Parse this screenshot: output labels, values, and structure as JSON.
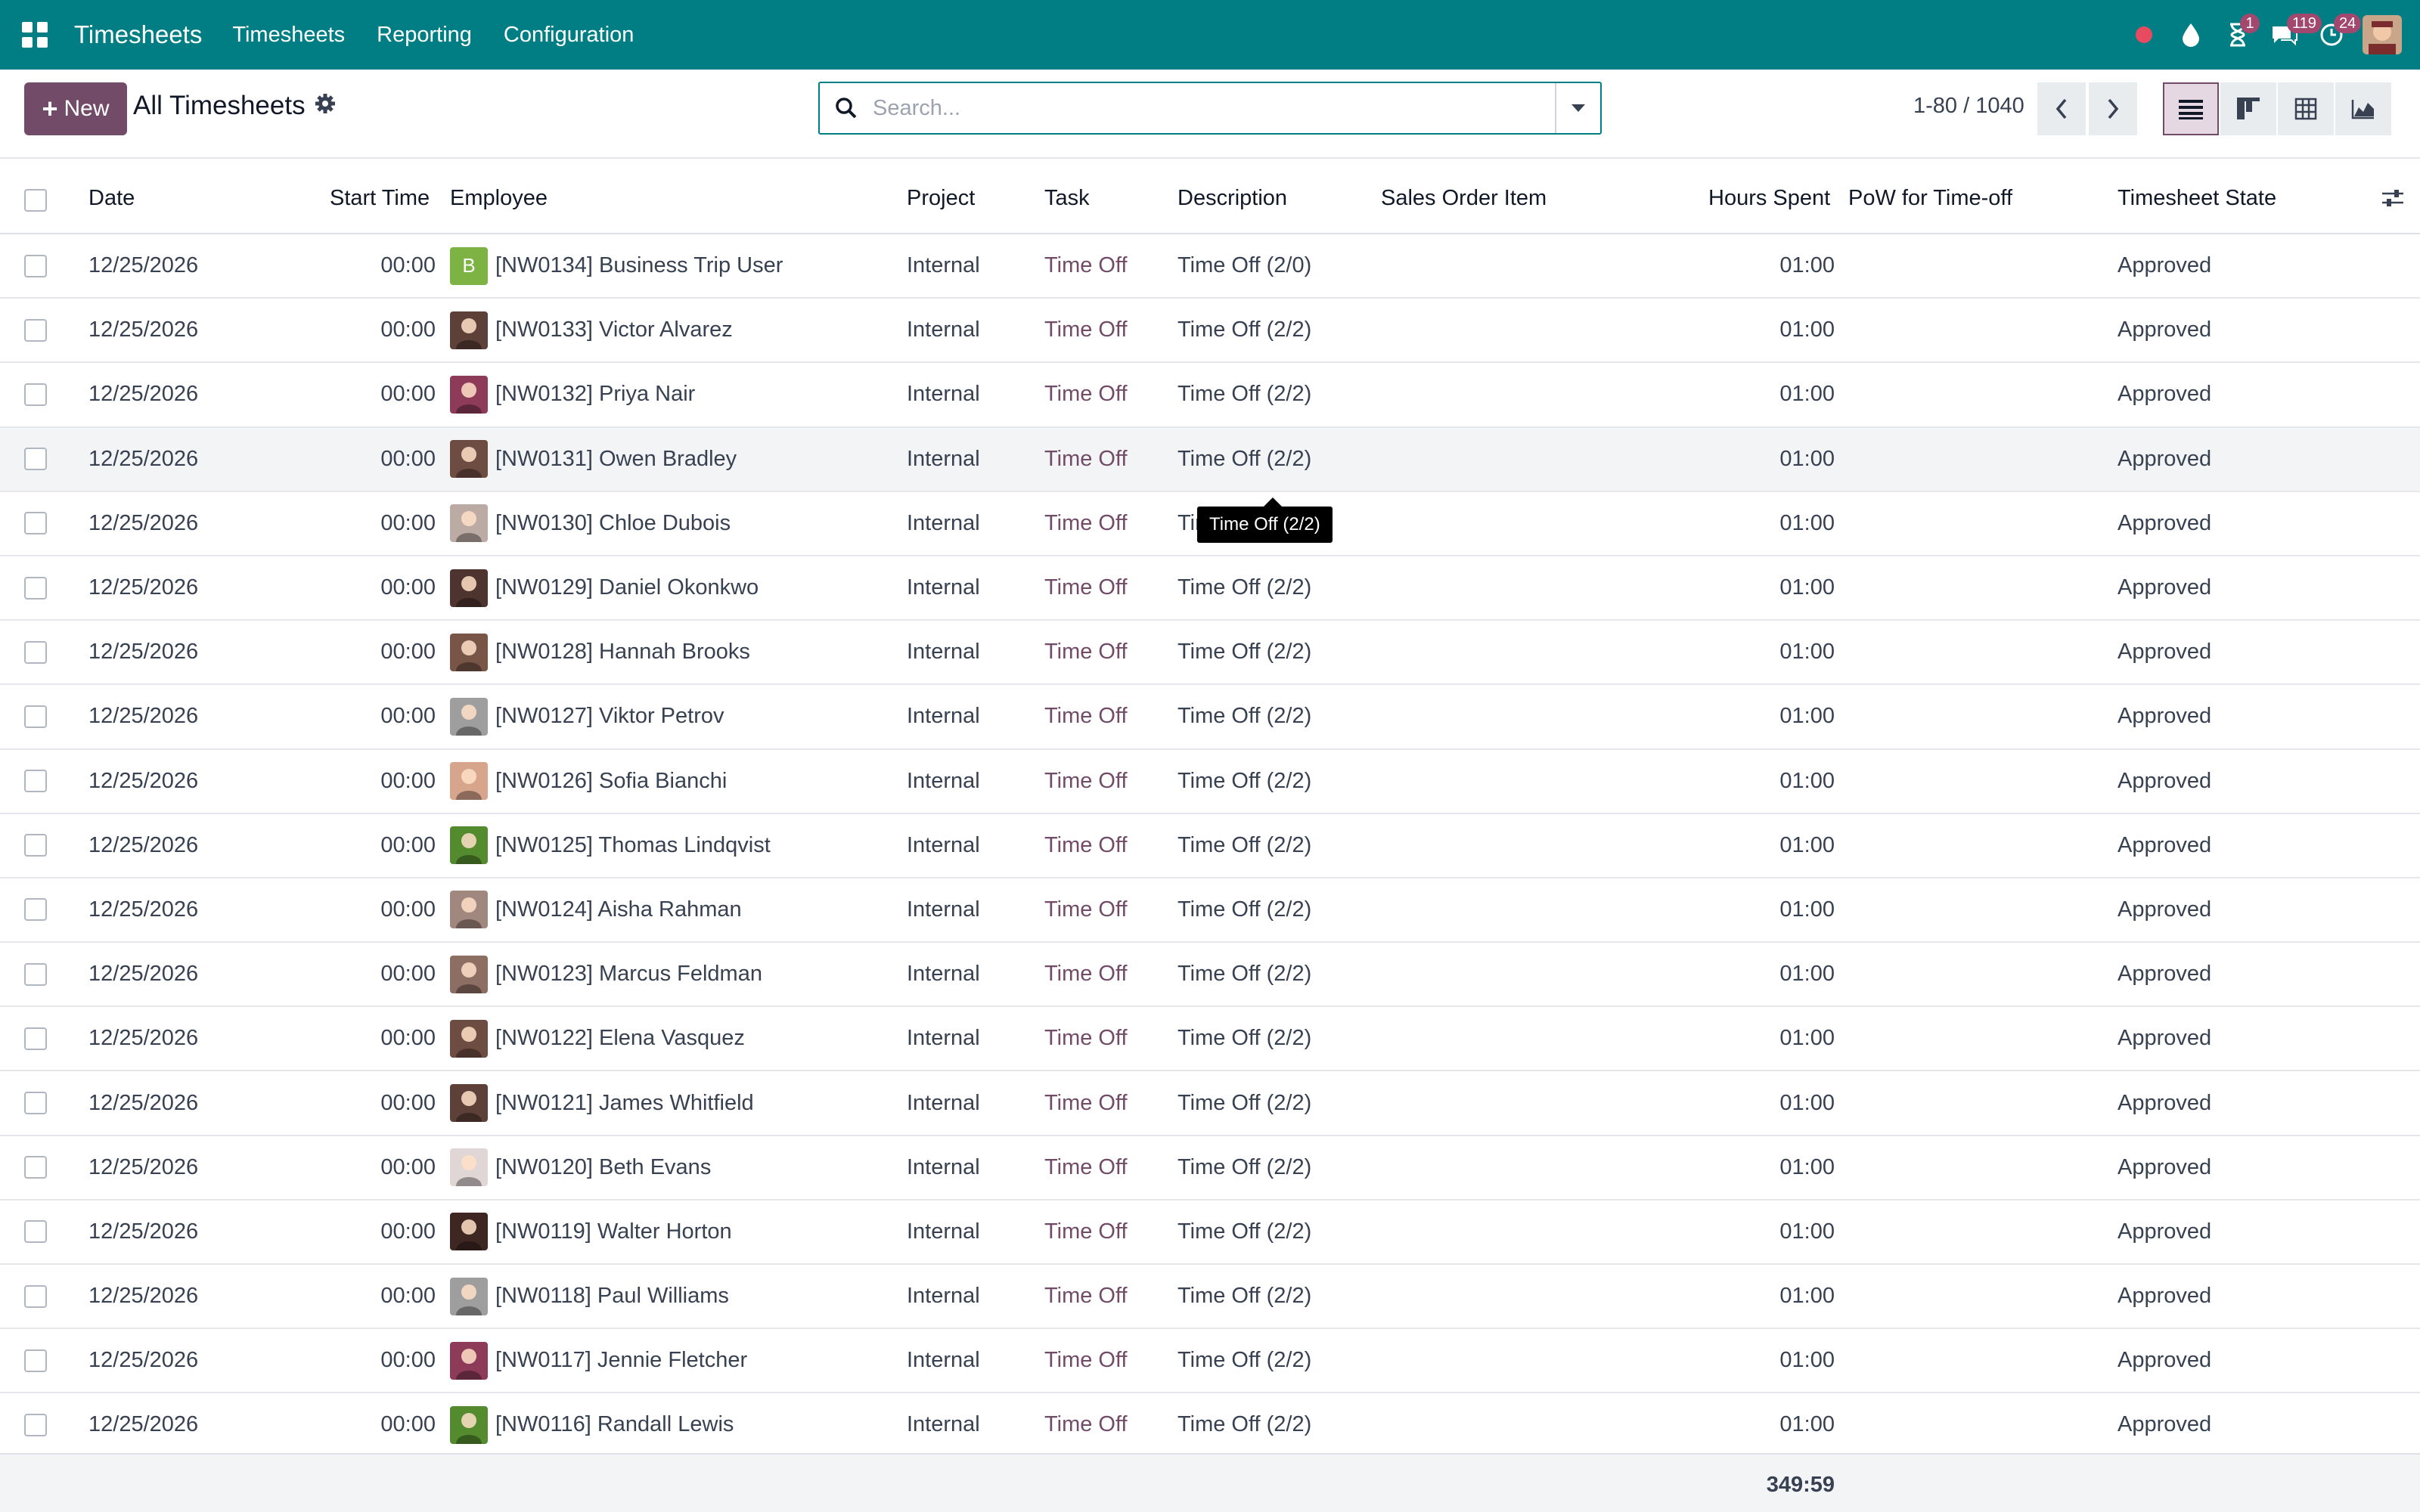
{
  "navbar": {
    "brand": "Timesheets",
    "menus": [
      "Timesheets",
      "Reporting",
      "Configuration"
    ],
    "badges": {
      "activities": "1",
      "messages": "119",
      "updates": "24"
    },
    "colors": {
      "bar": "#017e84",
      "badge": "#a2476e",
      "record_dot": "#e84a5f"
    }
  },
  "control_panel": {
    "new_label": "New",
    "breadcrumb": "All Timesheets",
    "search_placeholder": "Search...",
    "pager": "1-80 / 1040",
    "views": [
      "list-view-icon",
      "kanban-view-icon",
      "grid-view-icon",
      "graph-view-icon"
    ],
    "active_view": "list-view-icon"
  },
  "table": {
    "columns": [
      "Date",
      "Start Time",
      "Employee",
      "Project",
      "Task",
      "Description",
      "Sales Order Item",
      "Hours Spent",
      "PoW for Time-off",
      "Timesheet State"
    ],
    "rows": [
      {
        "date": "12/25/2026",
        "start": "00:00",
        "employee": "[NW0134] Business Trip User",
        "avatar_letter": "B",
        "avatar_color": "#7cb342",
        "project": "Internal",
        "task": "Time Off",
        "description": "Time Off (2/0)",
        "so_item": "",
        "hours": "01:00",
        "pow": "",
        "state": "Approved"
      },
      {
        "date": "12/25/2026",
        "start": "00:00",
        "employee": "[NW0133] Victor Alvarez",
        "avatar_letter": "",
        "avatar_color": "#5d4037",
        "project": "Internal",
        "task": "Time Off",
        "description": "Time Off (2/2)",
        "so_item": "",
        "hours": "01:00",
        "pow": "",
        "state": "Approved"
      },
      {
        "date": "12/25/2026",
        "start": "00:00",
        "employee": "[NW0132] Priya Nair",
        "avatar_letter": "",
        "avatar_color": "#8e3b5a",
        "project": "Internal",
        "task": "Time Off",
        "description": "Time Off (2/2)",
        "so_item": "",
        "hours": "01:00",
        "pow": "",
        "state": "Approved"
      },
      {
        "date": "12/25/2026",
        "start": "00:00",
        "employee": "[NW0131] Owen Bradley",
        "avatar_letter": "",
        "avatar_color": "#6d4c41",
        "project": "Internal",
        "task": "Time Off",
        "description": "Time Off (2/2)",
        "so_item": "",
        "hours": "01:00",
        "pow": "",
        "state": "Approved"
      },
      {
        "date": "12/25/2026",
        "start": "00:00",
        "employee": "[NW0130] Chloe Dubois",
        "avatar_letter": "",
        "avatar_color": "#bcaaa4",
        "project": "Internal",
        "task": "Time Off",
        "description": "Time Off (2/2)",
        "so_item": "",
        "hours": "01:00",
        "pow": "",
        "state": "Approved"
      },
      {
        "date": "12/25/2026",
        "start": "00:00",
        "employee": "[NW0129] Daniel Okonkwo",
        "avatar_letter": "",
        "avatar_color": "#4e342e",
        "project": "Internal",
        "task": "Time Off",
        "description": "Time Off (2/2)",
        "so_item": "",
        "hours": "01:00",
        "pow": "",
        "state": "Approved"
      },
      {
        "date": "12/25/2026",
        "start": "00:00",
        "employee": "[NW0128] Hannah Brooks",
        "avatar_letter": "",
        "avatar_color": "#795548",
        "project": "Internal",
        "task": "Time Off",
        "description": "Time Off (2/2)",
        "so_item": "",
        "hours": "01:00",
        "pow": "",
        "state": "Approved"
      },
      {
        "date": "12/25/2026",
        "start": "00:00",
        "employee": "[NW0127] Viktor Petrov",
        "avatar_letter": "",
        "avatar_color": "#9e9e9e",
        "project": "Internal",
        "task": "Time Off",
        "description": "Time Off (2/2)",
        "so_item": "",
        "hours": "01:00",
        "pow": "",
        "state": "Approved"
      },
      {
        "date": "12/25/2026",
        "start": "00:00",
        "employee": "[NW0126] Sofia Bianchi",
        "avatar_letter": "",
        "avatar_color": "#d7a48c",
        "project": "Internal",
        "task": "Time Off",
        "description": "Time Off (2/2)",
        "so_item": "",
        "hours": "01:00",
        "pow": "",
        "state": "Approved"
      },
      {
        "date": "12/25/2026",
        "start": "00:00",
        "employee": "[NW0125] Thomas Lindqvist",
        "avatar_letter": "",
        "avatar_color": "#558b2f",
        "project": "Internal",
        "task": "Time Off",
        "description": "Time Off (2/2)",
        "so_item": "",
        "hours": "01:00",
        "pow": "",
        "state": "Approved"
      },
      {
        "date": "12/25/2026",
        "start": "00:00",
        "employee": "[NW0124] Aisha Rahman",
        "avatar_letter": "",
        "avatar_color": "#a1887f",
        "project": "Internal",
        "task": "Time Off",
        "description": "Time Off (2/2)",
        "so_item": "",
        "hours": "01:00",
        "pow": "",
        "state": "Approved"
      },
      {
        "date": "12/25/2026",
        "start": "00:00",
        "employee": "[NW0123] Marcus Feldman",
        "avatar_letter": "",
        "avatar_color": "#8d6e63",
        "project": "Internal",
        "task": "Time Off",
        "description": "Time Off (2/2)",
        "so_item": "",
        "hours": "01:00",
        "pow": "",
        "state": "Approved"
      },
      {
        "date": "12/25/2026",
        "start": "00:00",
        "employee": "[NW0122] Elena Vasquez",
        "avatar_letter": "",
        "avatar_color": "#6d4c41",
        "project": "Internal",
        "task": "Time Off",
        "description": "Time Off (2/2)",
        "so_item": "",
        "hours": "01:00",
        "pow": "",
        "state": "Approved"
      },
      {
        "date": "12/25/2026",
        "start": "00:00",
        "employee": "[NW0121] James Whitfield",
        "avatar_letter": "",
        "avatar_color": "#5d4037",
        "project": "Internal",
        "task": "Time Off",
        "description": "Time Off (2/2)",
        "so_item": "",
        "hours": "01:00",
        "pow": "",
        "state": "Approved"
      },
      {
        "date": "12/25/2026",
        "start": "00:00",
        "employee": "[NW0120] Beth Evans",
        "avatar_letter": "",
        "avatar_color": "#e0d6d6",
        "project": "Internal",
        "task": "Time Off",
        "description": "Time Off (2/2)",
        "so_item": "",
        "hours": "01:00",
        "pow": "",
        "state": "Approved"
      },
      {
        "date": "12/25/2026",
        "start": "00:00",
        "employee": "[NW0119] Walter Horton",
        "avatar_letter": "",
        "avatar_color": "#3e2723",
        "project": "Internal",
        "task": "Time Off",
        "description": "Time Off (2/2)",
        "so_item": "",
        "hours": "01:00",
        "pow": "",
        "state": "Approved"
      },
      {
        "date": "12/25/2026",
        "start": "00:00",
        "employee": "[NW0118] Paul Williams",
        "avatar_letter": "",
        "avatar_color": "#9e9e9e",
        "project": "Internal",
        "task": "Time Off",
        "description": "Time Off (2/2)",
        "so_item": "",
        "hours": "01:00",
        "pow": "",
        "state": "Approved"
      },
      {
        "date": "12/25/2026",
        "start": "00:00",
        "employee": "[NW0117] Jennie Fletcher",
        "avatar_letter": "",
        "avatar_color": "#8e3b5a",
        "project": "Internal",
        "task": "Time Off",
        "description": "Time Off (2/2)",
        "so_item": "",
        "hours": "01:00",
        "pow": "",
        "state": "Approved"
      },
      {
        "date": "12/25/2026",
        "start": "00:00",
        "employee": "[NW0116] Randall Lewis",
        "avatar_letter": "",
        "avatar_color": "#558b2f",
        "project": "Internal",
        "task": "Time Off",
        "description": "Time Off (2/2)",
        "so_item": "",
        "hours": "01:00",
        "pow": "",
        "state": "Approved"
      }
    ],
    "hover_row": 3,
    "total_hours": "349:59"
  },
  "tooltip": {
    "text": "Time Off (2/2)",
    "row": 4
  }
}
